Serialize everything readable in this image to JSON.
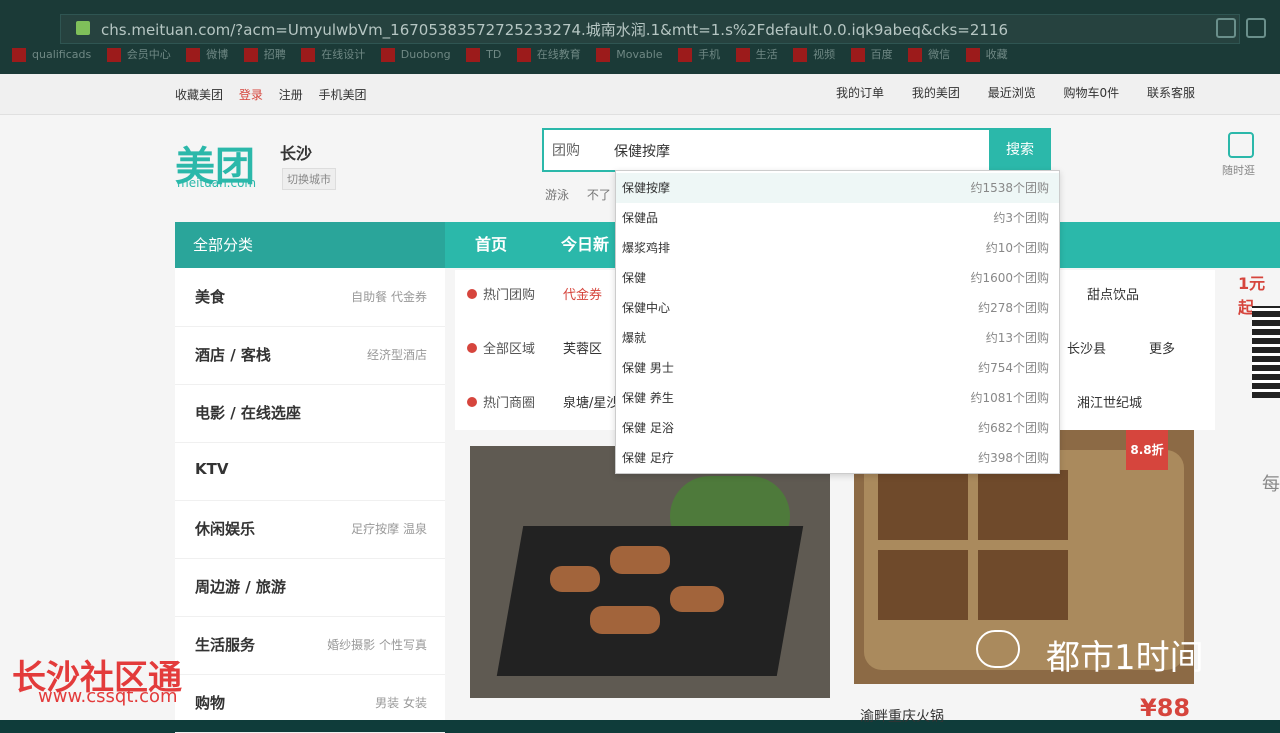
{
  "browser": {
    "url": "chs.meituan.com/?acm=UmyulwbVm_16705383572725233274.城南水润.1&mtt=1.s%2Fdefault.0.0.iqk9abeq&cks=2116",
    "bookmarks": [
      "qualificads",
      "会员中心",
      "微博",
      "招聘",
      "在线设计",
      "Duobong",
      "TD",
      "在线教育",
      "Movable",
      "手机",
      "生活",
      "视频",
      "百度",
      "微信",
      "收藏"
    ]
  },
  "topbar": {
    "left": [
      "收藏美团",
      "登录",
      "注册",
      "手机美团"
    ],
    "right": [
      "我的订单",
      "我的美团",
      "最近浏览",
      "购物车0件",
      "联系客服"
    ]
  },
  "header": {
    "logo": "美团",
    "logo_sub": "meituan.com",
    "city": "长沙",
    "switch_city": "切换城市",
    "search_type": "团购",
    "search_value": "保健按摩",
    "search_button": "搜索",
    "recommend": [
      "游泳",
      "不了"
    ],
    "app_label": "随时逛"
  },
  "nav": {
    "category_label": "全部分类",
    "items": [
      "首页",
      "今日新"
    ]
  },
  "categories": [
    {
      "main": "美食",
      "sub": "自助餐 代金券"
    },
    {
      "main": "酒店 / 客栈",
      "sub": "经济型酒店"
    },
    {
      "main": "电影 / 在线选座",
      "sub": ""
    },
    {
      "main": "KTV",
      "sub": ""
    },
    {
      "main": "休闲娱乐",
      "sub": "足疗按摩 温泉"
    },
    {
      "main": "周边游 / 旅游",
      "sub": ""
    },
    {
      "main": "生活服务",
      "sub": "婚纱摄影 个性写真"
    },
    {
      "main": "购物",
      "sub": "男装 女装"
    }
  ],
  "filters": {
    "hot_label": "热门团购",
    "hot_items": [
      "代金券"
    ],
    "area_label": "全部区域",
    "area_items": [
      "芙蓉区",
      "长沙县"
    ],
    "more": "更多",
    "mall_label": "热门商圈",
    "mall_items": [
      "泉塘/星沙",
      "湘江世纪城"
    ],
    "extra": "甜点饮品"
  },
  "dropdown": [
    {
      "term": "保健按摩",
      "count": "约1538个团购"
    },
    {
      "term": "保健品",
      "count": "约3个团购"
    },
    {
      "term": "爆浆鸡排",
      "count": "约10个团购"
    },
    {
      "term": "保健",
      "count": "约1600个团购"
    },
    {
      "term": "保健中心",
      "count": "约278个团购"
    },
    {
      "term": "爆就",
      "count": "约13个团购"
    },
    {
      "term": "保健 男士",
      "count": "约754个团购"
    },
    {
      "term": "保健 养生",
      "count": "约1081个团购"
    },
    {
      "term": "保健 足浴",
      "count": "约682个团购"
    },
    {
      "term": "保健 足疗",
      "count": "约398个团购"
    }
  ],
  "promo": {
    "right_label": "1元起",
    "discount": "8.8折",
    "price": "¥88",
    "title": "渝畔重庆火锅"
  },
  "overlay": {
    "watermark": "长沙社区通",
    "watermark_sub": "www.cssqt.com",
    "news_label": "都市1时间",
    "right_edge": "每"
  }
}
